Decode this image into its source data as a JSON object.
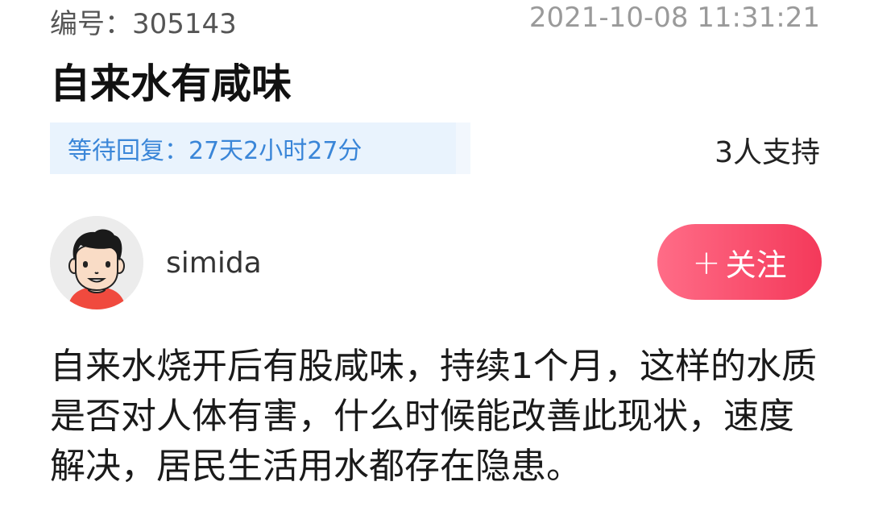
{
  "post": {
    "id_label": "编号：",
    "id_value": "305143",
    "timestamp": "2021-10-08 11:31:21",
    "title": "自来水有咸味",
    "wait_label": "等待回复：",
    "wait_value": "27天2小时27分",
    "support_count": "3人支持",
    "content": "自来水烧开后有股咸味，持续1个月，这样的水质是否对人体有害，什么时候能改善此现状，速度解决，居民生活用水都存在隐患。"
  },
  "author": {
    "avatar_icon": "cartoon-man-avatar-icon",
    "username": "simida",
    "follow_plus": "+",
    "follow_label": "关注"
  },
  "colors": {
    "follow_gradient_start": "#ff6c87",
    "follow_gradient_end": "#f4395a",
    "wait_badge_bg": "#e9f3fd",
    "wait_badge_text": "#3a86d8",
    "timestamp_text": "#9a9a9a"
  }
}
